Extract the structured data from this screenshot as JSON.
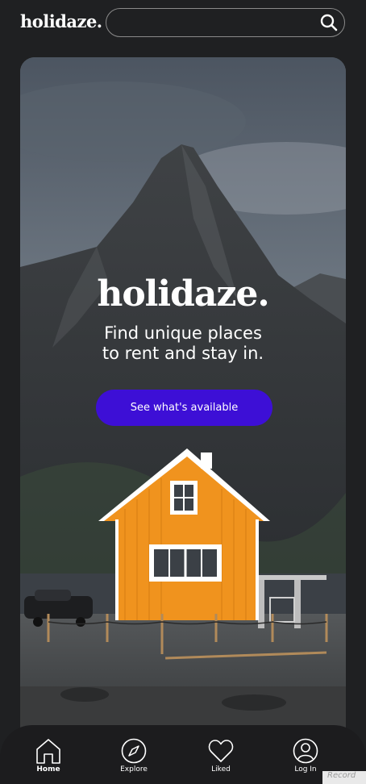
{
  "header": {
    "logo": "holidaze.",
    "search": {
      "value": "",
      "placeholder": ""
    }
  },
  "hero": {
    "logo": "holidaze.",
    "tagline_line1": "Find unique places",
    "tagline_line2": "to rent and stay in.",
    "cta_label": "See what's available"
  },
  "nav": {
    "items": [
      {
        "label": "Home",
        "icon": "home-icon"
      },
      {
        "label": "Explore",
        "icon": "compass-icon"
      },
      {
        "label": "Liked",
        "icon": "heart-icon"
      },
      {
        "label": "Log In",
        "icon": "user-icon"
      }
    ]
  },
  "overlay": {
    "recorder_text": "Record"
  },
  "colors": {
    "background": "#1f2022",
    "accent": "#3d0fd6",
    "house": "#f0931e"
  }
}
